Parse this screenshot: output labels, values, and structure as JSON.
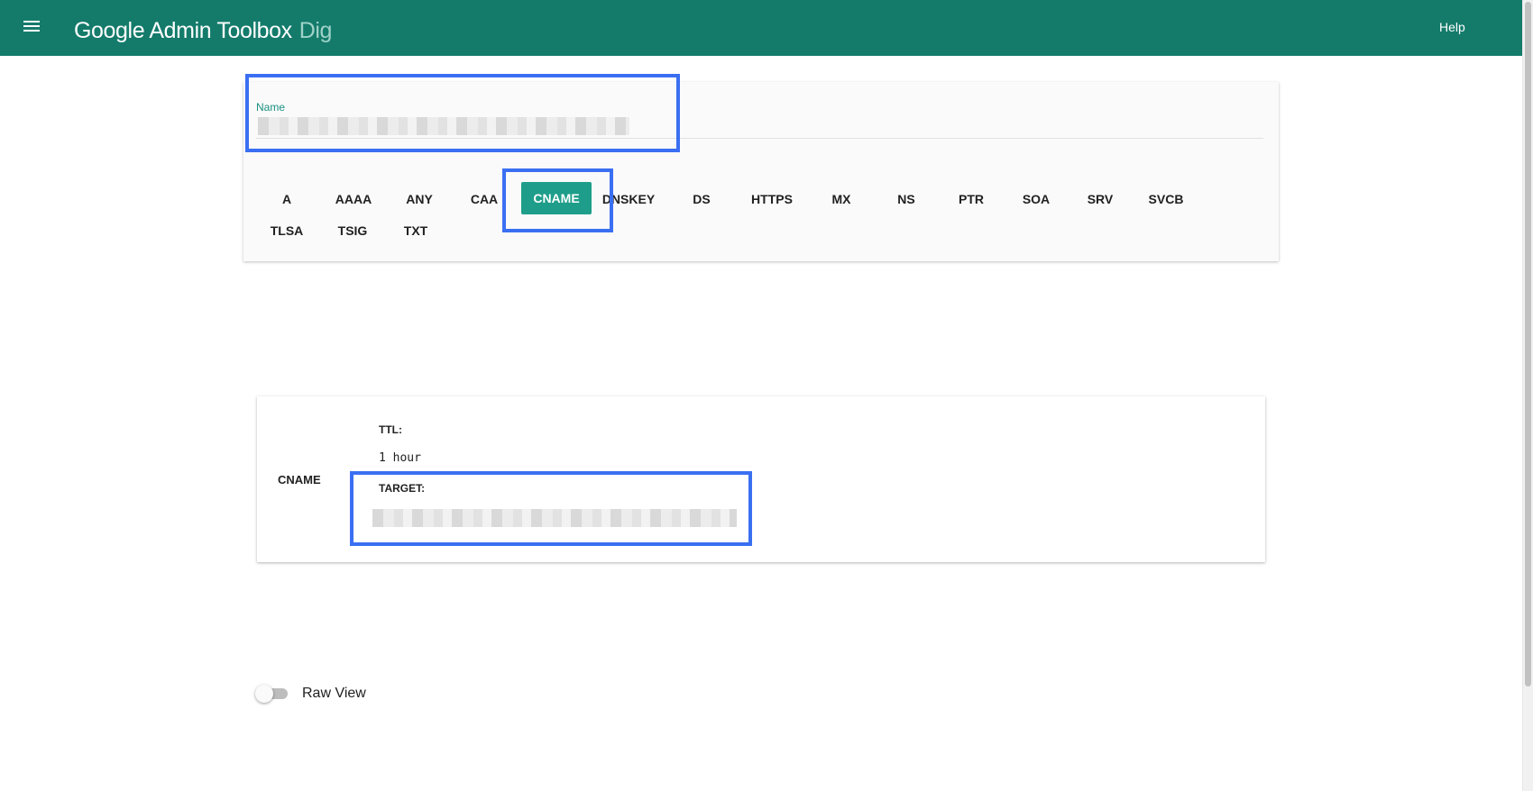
{
  "header": {
    "title": "Google Admin Toolbox",
    "subtitle": "Dig",
    "help_label": "Help",
    "background_color": "#147b6b"
  },
  "query": {
    "name_label": "Name",
    "name_value": ""
  },
  "record_types": {
    "selected": "CNAME",
    "active_color": "#1e9e8a",
    "items": [
      "A",
      "AAAA",
      "ANY",
      "CAA",
      "CNAME",
      "DNSKEY",
      "DS",
      "HTTPS",
      "MX",
      "NS",
      "PTR",
      "SOA",
      "SRV",
      "SVCB",
      "TLSA",
      "TSIG",
      "TXT"
    ]
  },
  "result": {
    "record_type": "CNAME",
    "ttl_label": "TTL:",
    "ttl_value": "1 hour",
    "target_label": "TARGET:",
    "target_value": ""
  },
  "raw_view": {
    "label": "Raw View",
    "enabled": false
  },
  "highlight_color": "#3b6ff2"
}
